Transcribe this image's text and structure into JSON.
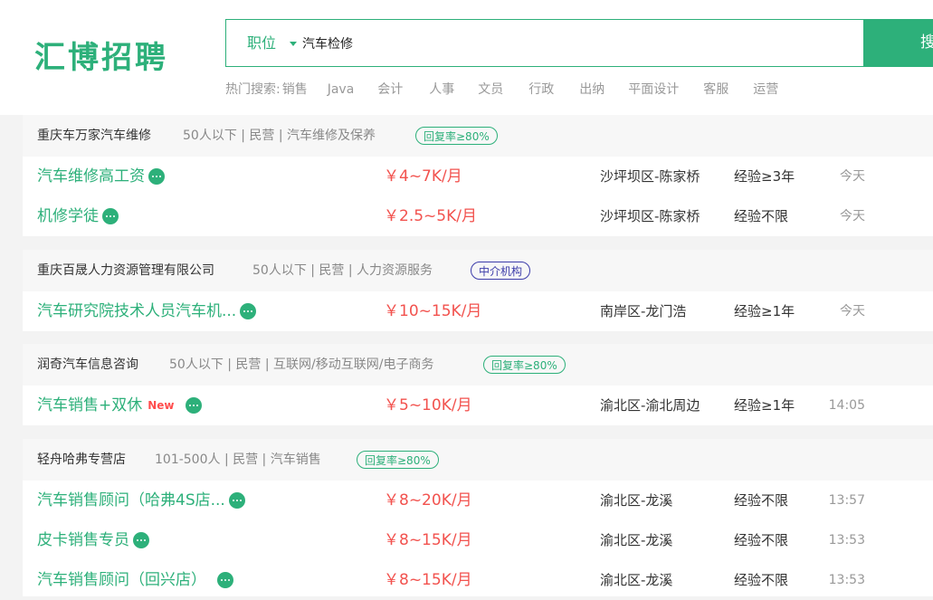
{
  "header": {
    "logo": "汇博招聘",
    "search": {
      "type_label": "职位",
      "query": "汽车检修",
      "button_label": "搜"
    },
    "hot_label": "热门搜索:",
    "hot_items": [
      "销售",
      "Java",
      "会计",
      "人事",
      "文员",
      "行政",
      "出纳",
      "平面设计",
      "客服",
      "运营"
    ]
  },
  "companies": [
    {
      "name": "重庆车万家汽车维修",
      "meta": "50人以下 | 民营 | 汽车维修及保养",
      "badge": "回复率≥80%",
      "jobs": [
        {
          "title": "汽车维修高工资",
          "new": "",
          "salary": "￥4~7K/月",
          "location": "沙坪坝区-陈家桥",
          "experience": "经验≥3年",
          "time": "今天"
        },
        {
          "title": "机修学徒",
          "new": "",
          "salary": "￥2.5~5K/月",
          "location": "沙坪坝区-陈家桥",
          "experience": "经验不限",
          "time": "今天"
        }
      ]
    },
    {
      "name": "重庆百晟人力资源管理有限公司",
      "meta": "50人以下 | 民营 | 人力资源服务",
      "badge": "中介机构",
      "jobs": [
        {
          "title": "汽车研究院技术人员汽车机...",
          "new": "",
          "salary": "￥10~15K/月",
          "location": "南岸区-龙门浩",
          "experience": "经验≥1年",
          "time": "今天"
        }
      ]
    },
    {
      "name": "润奇汽车信息咨询",
      "meta": "50人以下 | 民营 | 互联网/移动互联网/电子商务",
      "badge": "回复率≥80%",
      "jobs": [
        {
          "title": "汽车销售+双休",
          "new": "New",
          "salary": "￥5~10K/月",
          "location": "渝北区-渝北周边",
          "experience": "经验≥1年",
          "time": "14:05"
        }
      ]
    },
    {
      "name": "轻舟哈弗专营店",
      "meta": "101-500人 | 民营 | 汽车销售",
      "badge": "回复率≥80%",
      "jobs": [
        {
          "title": "汽车销售顾问（哈弗4S店...",
          "new": "",
          "salary": "￥8~20K/月",
          "location": "渝北区-龙溪",
          "experience": "经验不限",
          "time": "13:57"
        },
        {
          "title": "皮卡销售专员",
          "new": "",
          "salary": "￥8~15K/月",
          "location": "渝北区-龙溪",
          "experience": "经验不限",
          "time": "13:53"
        },
        {
          "title": "汽车销售顾问（回兴店）",
          "new": "",
          "salary": "￥8~15K/月",
          "location": "渝北区-龙溪",
          "experience": "经验不限",
          "time": "13:53"
        }
      ]
    }
  ],
  "colors": {
    "brand": "#2db07a",
    "salary": "#f2524e",
    "agency": "#3c3caa",
    "new": "#ff4d4d"
  },
  "icons": {
    "chat": "chat-bubble-icon",
    "dropdown": "caret-down-icon"
  }
}
